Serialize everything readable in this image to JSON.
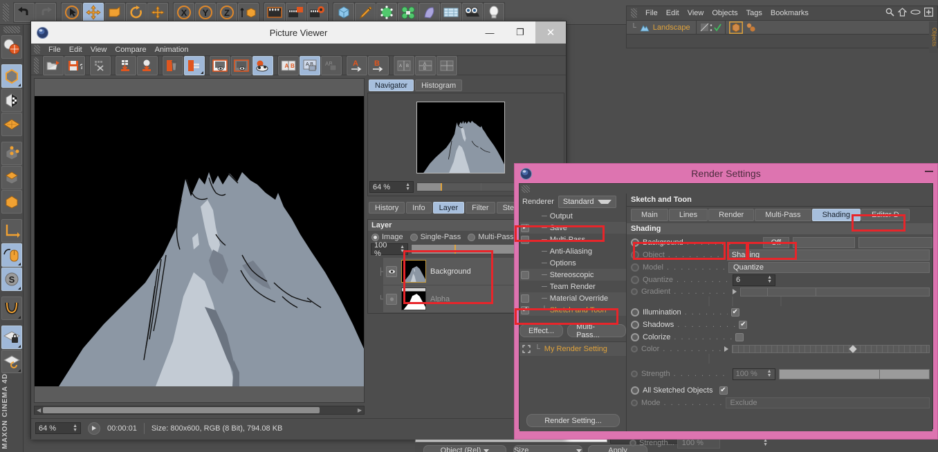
{
  "app": {
    "brand": "MAXON CINEMA 4D"
  },
  "object_manager": {
    "menus": [
      "File",
      "Edit",
      "View",
      "Objects",
      "Tags",
      "Bookmarks"
    ],
    "icons": [
      "search-icon",
      "home-icon",
      "eye-icon",
      "add-icon"
    ],
    "object_name": "Landscape",
    "side_label": "Objects"
  },
  "picture_viewer": {
    "title": "Picture Viewer",
    "menus": [
      "File",
      "Edit",
      "View",
      "Compare",
      "Animation"
    ],
    "window_buttons": {
      "minimize": "—",
      "maximize": "❐",
      "close": "✕"
    },
    "navigator": {
      "tabs": [
        {
          "label": "Navigator",
          "active": true
        },
        {
          "label": "Histogram",
          "active": false
        }
      ],
      "zoom": "64 %"
    },
    "layer_panel": {
      "tabs": [
        {
          "label": "History",
          "active": false
        },
        {
          "label": "Info",
          "active": false
        },
        {
          "label": "Layer",
          "active": true
        },
        {
          "label": "Filter",
          "active": false
        },
        {
          "label": "Stere",
          "active": false
        }
      ],
      "section_title": "Layer",
      "modes": [
        {
          "label": "Image",
          "selected": true
        },
        {
          "label": "Single-Pass",
          "selected": false
        },
        {
          "label": "Multi-Pass",
          "selected": false
        }
      ],
      "opacity": "100 %",
      "layers": [
        {
          "name": "Background",
          "visible": true,
          "selected": true
        },
        {
          "name": "Alpha",
          "visible": false,
          "selected": false
        }
      ]
    },
    "status": {
      "zoom": "64 %",
      "time": "00:00:01",
      "info": "Size: 800x600, RGB (8 Bit), 794.08 KB"
    }
  },
  "render_settings": {
    "title": "Render Settings",
    "renderer_label": "Renderer",
    "renderer_value": "Standard",
    "tree": [
      {
        "label": "Output",
        "checkbox": "none",
        "orange": false
      },
      {
        "label": "Save",
        "checkbox": "checked",
        "orange": false
      },
      {
        "label": "Multi-Pass",
        "checkbox": "blank",
        "orange": false
      },
      {
        "label": "Anti-Aliasing",
        "checkbox": "none",
        "orange": false
      },
      {
        "label": "Options",
        "checkbox": "none",
        "orange": false
      },
      {
        "label": "Stereoscopic",
        "checkbox": "blank",
        "orange": false
      },
      {
        "label": "Team Render",
        "checkbox": "none",
        "orange": false
      },
      {
        "label": "Material Override",
        "checkbox": "blank",
        "orange": false
      },
      {
        "label": "Sketch and Toon",
        "checkbox": "checked",
        "orange": true
      }
    ],
    "buttons": {
      "effect": "Effect...",
      "multipass": "Multi-Pass...",
      "render_setting": "Render Setting..."
    },
    "preset_name": "My Render Setting",
    "panel_title": "Sketch and Toon",
    "tabs": [
      {
        "label": "Main",
        "active": false
      },
      {
        "label": "Lines",
        "active": false
      },
      {
        "label": "Render",
        "active": false
      },
      {
        "label": "Multi-Pass",
        "active": false
      },
      {
        "label": "Shading",
        "active": true
      },
      {
        "label": "Editor D",
        "active": false
      }
    ],
    "shading_header": "Shading",
    "properties": [
      {
        "name": "Background",
        "value": "Off",
        "type": "button-field",
        "enabled": true
      },
      {
        "name": "Object",
        "value": "Shading",
        "type": "field",
        "enabled": true
      },
      {
        "name": "Model",
        "value": "Quantize",
        "type": "field",
        "enabled": true
      },
      {
        "name": "Quantize",
        "value": "6",
        "type": "spinner",
        "enabled": true
      },
      {
        "name": "Gradient",
        "value": "",
        "type": "gradient",
        "enabled": false
      },
      {
        "name": "Illumination",
        "value": "checked",
        "type": "checkbox",
        "enabled": true
      },
      {
        "name": "Shadows",
        "value": "checked",
        "type": "checkbox",
        "enabled": true
      },
      {
        "name": "Colorize",
        "value": "blank",
        "type": "checkbox",
        "enabled": true
      },
      {
        "name": "Color",
        "value": "",
        "type": "colorbar",
        "enabled": false
      },
      {
        "name": "Strength",
        "value": "100 %",
        "type": "spinner",
        "enabled": false
      },
      {
        "name": "All Sketched Objects",
        "value": "checked",
        "type": "checkbox",
        "enabled": true
      },
      {
        "name": "Mode",
        "value": "Exclude",
        "type": "field",
        "enabled": false
      }
    ]
  },
  "bottom_strip": {
    "dropdown1": "Object (Rel)",
    "dropdown2": "Size",
    "apply": "Apply",
    "strength_label": "Strength...",
    "strength_value": "100 %"
  },
  "colors": {
    "window_accent": "#dd74b0",
    "annotation": "#e8252a",
    "tab_active": "#a7bfdd",
    "orange_text": "#e0a33c"
  }
}
